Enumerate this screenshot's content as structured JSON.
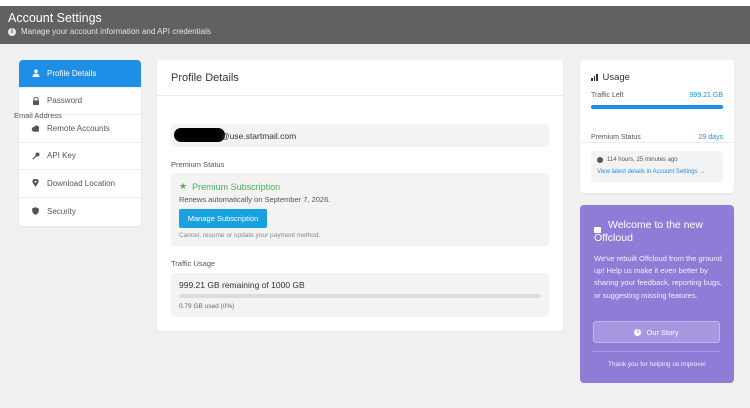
{
  "header": {
    "title": "Account Settings",
    "subtitle": "Manage your account information and API credentials"
  },
  "sidebar": {
    "items": [
      {
        "label": "Profile Details",
        "icon": "user-icon",
        "active": true
      },
      {
        "label": "Password",
        "icon": "lock-icon"
      },
      {
        "label": "Remote Accounts",
        "icon": "cloud-icon"
      },
      {
        "label": "API Key",
        "icon": "key-icon"
      },
      {
        "label": "Download Location",
        "icon": "map-pin-icon"
      },
      {
        "label": "Security",
        "icon": "shield-icon"
      }
    ]
  },
  "profile": {
    "title": "Profile Details",
    "email_label": "Email Address",
    "email_value": "@use.startmail.com",
    "premium_label": "Premium Status",
    "premium_title": "Premium Subscription",
    "renews": "Renews automatically on September 7, 2026.",
    "manage_button": "Manage Subscription",
    "manage_note": "Cancel, resume or update your payment method.",
    "traffic_label": "Traffic Usage",
    "traffic_remaining": "999.21 GB remaining of 1000 GB",
    "traffic_used": "0.79 GB used (0%)",
    "traffic_used_fraction": 0.0
  },
  "usage": {
    "title": "Usage",
    "traffic_left_label": "Traffic Left",
    "traffic_left_value": "999.21 GB",
    "traffic_left_fraction": 0.999,
    "premium_status_label": "Premium Status",
    "premium_status_value": "29 days",
    "reset_time": "114 hours, 25 minutes ago",
    "reset_link": "View latest details in Account Settings →"
  },
  "welcome": {
    "title": "Welcome to the new Offcloud",
    "text": "We've rebuilt Offcloud from the ground up! Help us make it even better by sharing your feedback, reporting bugs, or suggesting missing features.",
    "story_button": "Our Story",
    "thanks": "Thank you for helping us improve!"
  },
  "colors": {
    "header_bg": "#5f6163",
    "accent": "#1f8ee6",
    "button": "#18a0e0",
    "success": "#4caf50",
    "welcome_bg": "#8e7cd6"
  }
}
